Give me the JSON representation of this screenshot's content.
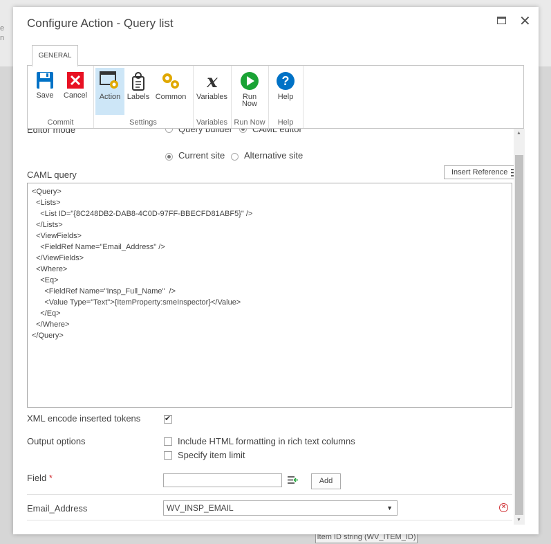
{
  "background": {
    "left_text": [
      "e",
      "n"
    ],
    "chip": "Item ID string (WV_ITEM_ID)"
  },
  "dialog": {
    "title": "Configure Action - Query list"
  },
  "ribbon": {
    "tab": "GENERAL",
    "groups": [
      {
        "label": "Commit",
        "buttons": [
          "Save",
          "Cancel"
        ]
      },
      {
        "label": "Settings",
        "buttons": [
          "Action",
          "Labels",
          "Common"
        ]
      },
      {
        "label": "Variables",
        "buttons": [
          "Variables"
        ]
      },
      {
        "label": "Run Now",
        "buttons": [
          "Run Now"
        ]
      },
      {
        "label": "Help",
        "buttons": [
          "Help"
        ]
      }
    ]
  },
  "form": {
    "editor_mode_label": "Editor mode",
    "editor_mode_options": [
      "Query builder",
      "CAML editor"
    ],
    "editor_mode_selected": "CAML editor",
    "site_options": [
      "Current site",
      "Alternative site"
    ],
    "site_selected": "Current site",
    "caml_label": "CAML query",
    "insert_reference": "Insert Reference",
    "caml_text": "<Query>\n  <Lists>\n    <List ID=\"{8C248DB2-DAB8-4C0D-97FF-BBECFD81ABF5}\" />\n  </Lists>\n  <ViewFields>\n    <FieldRef Name=\"Email_Address\" />\n  </ViewFields>\n  <Where>\n    <Eq>\n      <FieldRef Name=\"Insp_Full_Name\"  />\n      <Value Type=\"Text\">{ItemProperty:smeInspector}</Value>\n    </Eq>\n  </Where>\n</Query>",
    "xml_encode_label": "XML encode inserted tokens",
    "xml_encode_checked": true,
    "output_options_label": "Output options",
    "output_options": [
      {
        "label": "Include HTML formatting in rich text columns",
        "checked": false
      },
      {
        "label": "Specify item limit",
        "checked": false
      }
    ],
    "field_label": "Field",
    "field_required_mark": "*",
    "field_value": "",
    "add_button": "Add",
    "mapping": {
      "field": "Email_Address",
      "variable": "WV_INSP_EMAIL"
    }
  },
  "colors": {
    "accent_blue": "#0072c6",
    "danger_red": "#d13438",
    "active_bg": "#cde6f7"
  }
}
